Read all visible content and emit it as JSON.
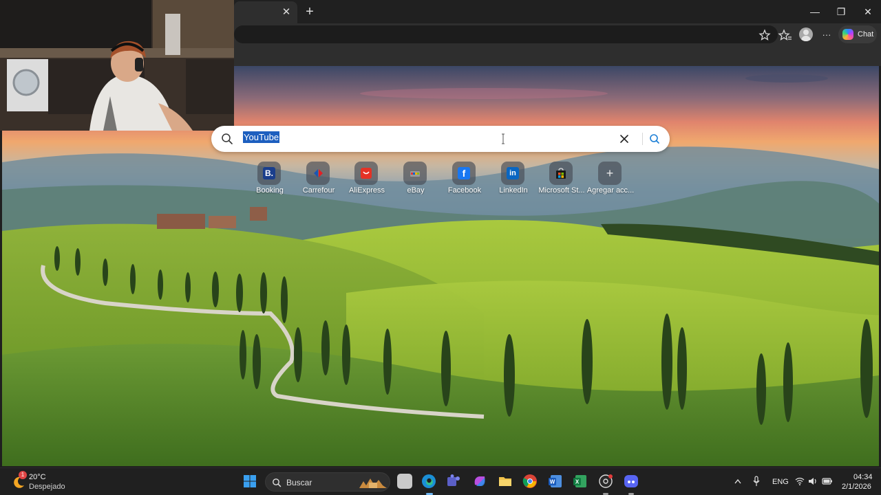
{
  "browser": {
    "tab_close": "✕",
    "new_tab": "+",
    "window_controls": {
      "minimize": "—",
      "maximize": "❐",
      "close": "✕"
    },
    "toolbar": {
      "chat_label": "Chat",
      "more": "···"
    }
  },
  "search": {
    "value": "YouTube",
    "icon": "search-icon"
  },
  "quick_links": [
    {
      "label": "Booking",
      "icon": "booking-icon",
      "glyph": "B.",
      "color": "#1a3e8c"
    },
    {
      "label": "Carrefour",
      "icon": "carrefour-icon",
      "glyph": "",
      "color": "#1c55b3"
    },
    {
      "label": "AliExpress",
      "icon": "aliexpress-icon",
      "glyph": "",
      "color": "#e43225"
    },
    {
      "label": "eBay",
      "icon": "ebay-icon",
      "glyph": "",
      "color": "#7a7a7a"
    },
    {
      "label": "Facebook",
      "icon": "facebook-icon",
      "glyph": "f",
      "color": "#1877f2"
    },
    {
      "label": "LinkedIn",
      "icon": "linkedin-icon",
      "glyph": "in",
      "color": "#0a66c2"
    },
    {
      "label": "Microsoft St...",
      "icon": "microsoft-store-icon",
      "glyph": "",
      "color": "#1f1f1f"
    },
    {
      "label": "Agregar acc...",
      "icon": "plus-icon",
      "glyph": "+",
      "color": "transparent"
    }
  ],
  "taskbar": {
    "weather_temp": "20°C",
    "weather_desc": "Despejado",
    "weather_badge": "1",
    "search_label": "Buscar",
    "language": "ENG",
    "time": "04:34",
    "date": "2/1/2026"
  }
}
